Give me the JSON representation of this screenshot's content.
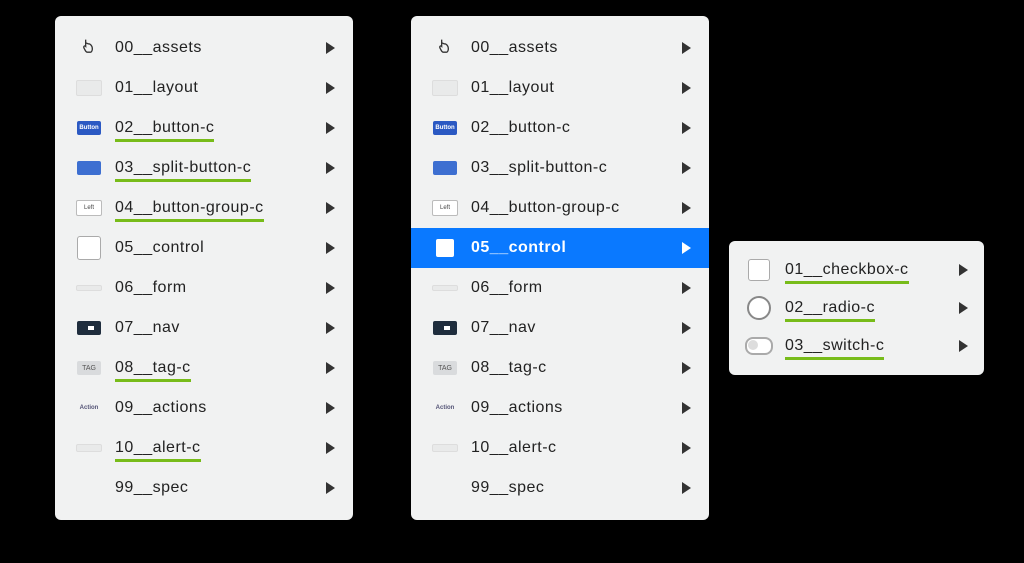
{
  "panels": {
    "left": [
      {
        "icon": "cursor",
        "label": "00__assets",
        "green": false
      },
      {
        "icon": "blank",
        "label": "01__layout",
        "green": false
      },
      {
        "icon": "btn-blue",
        "label": "02__button-c",
        "green": true
      },
      {
        "icon": "btn-blue2",
        "label": "03__split-button-c",
        "green": true
      },
      {
        "icon": "btn-white-left",
        "label": "04__button-group-c",
        "green": true
      },
      {
        "icon": "square",
        "label": "05__control",
        "green": false
      },
      {
        "icon": "blank",
        "label": "06__form",
        "green": false
      },
      {
        "icon": "nav-dark",
        "label": "07__nav",
        "green": false
      },
      {
        "icon": "tag",
        "label": "08__tag-c",
        "green": true
      },
      {
        "icon": "tiny-action",
        "label": "09__actions",
        "green": false
      },
      {
        "icon": "blank",
        "label": "10__alert-c",
        "green": true
      },
      {
        "icon": "none",
        "label": "99__spec",
        "green": false
      }
    ],
    "middle": [
      {
        "icon": "cursor",
        "label": "00__assets",
        "green": false
      },
      {
        "icon": "blank",
        "label": "01__layout",
        "green": false
      },
      {
        "icon": "btn-blue",
        "label": "02__button-c",
        "green": false
      },
      {
        "icon": "btn-blue2",
        "label": "03__split-button-c",
        "green": false
      },
      {
        "icon": "btn-white-left",
        "label": "04__button-group-c",
        "green": false
      },
      {
        "icon": "square-sel",
        "label": "05__control",
        "green": false,
        "selected": true
      },
      {
        "icon": "blank",
        "label": "06__form",
        "green": false
      },
      {
        "icon": "nav-dark",
        "label": "07__nav",
        "green": false
      },
      {
        "icon": "tag",
        "label": "08__tag-c",
        "green": false
      },
      {
        "icon": "tiny-action",
        "label": "09__actions",
        "green": false
      },
      {
        "icon": "blank",
        "label": "10__alert-c",
        "green": false
      },
      {
        "icon": "none",
        "label": "99__spec",
        "green": false
      }
    ],
    "right": [
      {
        "icon": "square",
        "label": "01__checkbox-c",
        "green": true
      },
      {
        "icon": "circle",
        "label": "02__radio-c",
        "green": true
      },
      {
        "icon": "switch",
        "label": "03__switch-c",
        "green": true
      }
    ]
  },
  "icon_text": {
    "btn-blue": "Button",
    "btn-white-left": "Left",
    "tag": "TAG",
    "tiny-action": "Action"
  }
}
